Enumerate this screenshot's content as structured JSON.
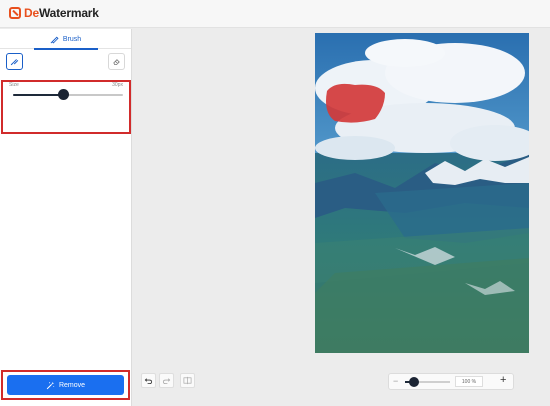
{
  "app": {
    "logo_prefix": "De",
    "logo_suffix": "Watermark",
    "brand_color": "#e8501e"
  },
  "sidebar": {
    "tab_brush_label": "Brush",
    "tools": [
      "brush-tool",
      "eraser-tool"
    ],
    "size": {
      "label": "Size",
      "value_text": "30px",
      "level": 0.45
    }
  },
  "actions": {
    "remove_label": "Remove",
    "accent_color": "#1a6ff0"
  },
  "history": {
    "undo": "undo-icon",
    "redo": "redo-icon",
    "compare": "compare-icon"
  },
  "zoom": {
    "minus": "−",
    "value_text": "100 %",
    "plus": "+",
    "level": 0.2
  },
  "colors": {
    "mask": "#d23a3a",
    "highlight": "#d12b2b"
  }
}
